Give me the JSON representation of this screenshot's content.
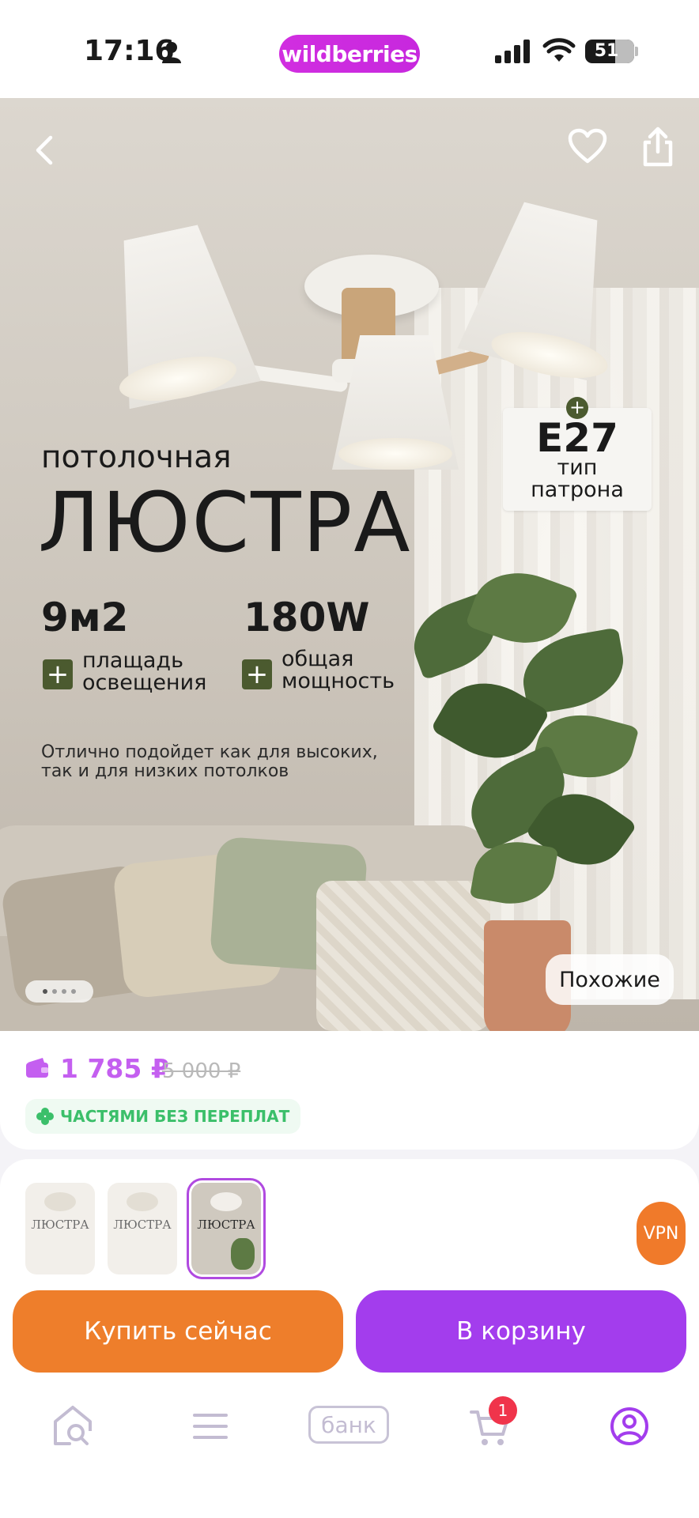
{
  "status_bar": {
    "time": "17:16",
    "brand": "wildberries",
    "battery": "51"
  },
  "product_image": {
    "subtitle": "потолочная",
    "title": "ЛЮСТРА",
    "stats": [
      {
        "value": "9м2",
        "label_line1": "плащадь",
        "label_line2": "освещения"
      },
      {
        "value": "180W",
        "label_line1": "общая",
        "label_line2": "мощность"
      }
    ],
    "socket": {
      "value": "E27",
      "line1": "тип",
      "line2": "патрона"
    },
    "description_line1": "Отлично подойдет как для высоких,",
    "description_line2": "так и для низких потолков",
    "similar_label": "Похожие",
    "slide_count": 4,
    "active_slide": 1
  },
  "price": {
    "current": "1 785 ₽",
    "old": "5 000 ₽",
    "installment_label": "ЧАСТЯМИ БЕЗ ПЕРЕПЛАТ"
  },
  "thumbnails": [
    {
      "text": "ЛЮСТРА",
      "selected": false
    },
    {
      "text": "ЛЮСТРА",
      "selected": false
    },
    {
      "text": "ЛЮСТРА",
      "selected": true
    }
  ],
  "vpn_label": "VPN",
  "actions": {
    "buy_now": "Купить сейчас",
    "add_to_cart": "В корзину"
  },
  "tabbar": {
    "bank_label": "банк",
    "cart_badge": "1"
  },
  "colors": {
    "brand": "#c728de",
    "price": "#c45ff0",
    "buy_now": "#ee7e2b",
    "cart": "#a33ded",
    "installment": "#3bbf6a",
    "badge": "#f0344b"
  }
}
